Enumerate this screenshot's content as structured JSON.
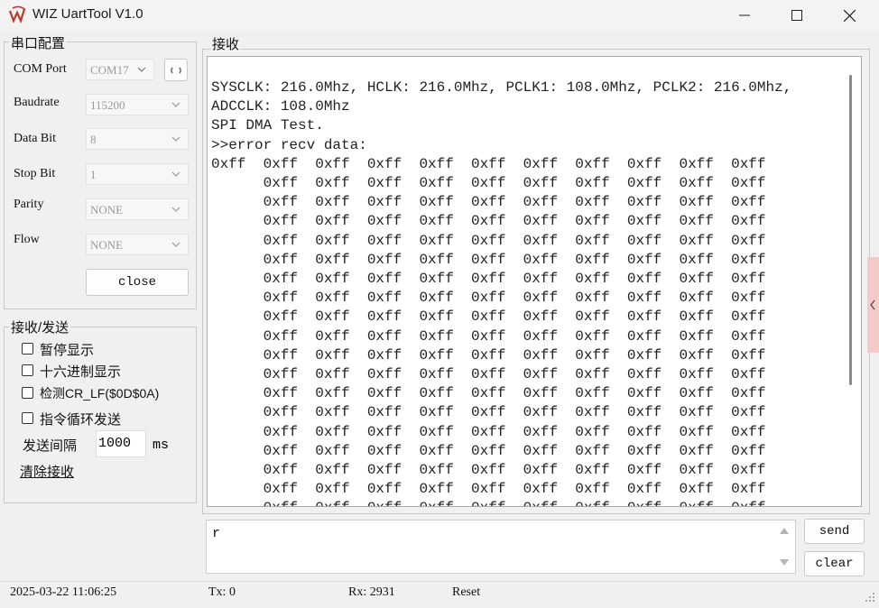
{
  "window": {
    "title": "WIZ UartTool V1.0"
  },
  "serial_config": {
    "group_title": "串口配置",
    "com_port": {
      "label": "COM Port",
      "value": "COM17"
    },
    "baudrate": {
      "label": "Baudrate",
      "value": "115200"
    },
    "data_bit": {
      "label": "Data Bit",
      "value": "8"
    },
    "stop_bit": {
      "label": "Stop Bit",
      "value": "1"
    },
    "parity": {
      "label": "Parity",
      "value": "NONE"
    },
    "flow": {
      "label": "Flow",
      "value": "NONE"
    },
    "close_label": "close"
  },
  "rx_tx": {
    "group_title": "接收/发送",
    "pause_label": "暂停显示",
    "hex_label": "十六进制显示",
    "crlf_label": "检测CR_LF($0D$0A)",
    "loop_label": "指令循环发送",
    "interval_label": "发送间隔",
    "interval_value": "1000",
    "interval_unit": "ms",
    "clear_recv_label": "清除接收"
  },
  "receive": {
    "group_title": "接收",
    "header_lines": [
      "SYSCLK: 216.0Mhz, HCLK: 216.0Mhz, PCLK1: 108.0Mhz, PCLK2: 216.0Mhz,",
      "ADCCLK: 108.0Mhz",
      "SPI DMA Test.",
      ">>error recv data:"
    ],
    "first_row_lead": "0xff",
    "hex_token": "0xff",
    "hex_cols": 10,
    "hex_rows": 19
  },
  "send": {
    "input_value": "r",
    "send_label": "send",
    "clear_label": "clear"
  },
  "status_bar": {
    "datetime": "2025-03-22 11:06:25",
    "tx": "Tx: 0",
    "rx": "Rx: 2931",
    "reset": "Reset"
  }
}
